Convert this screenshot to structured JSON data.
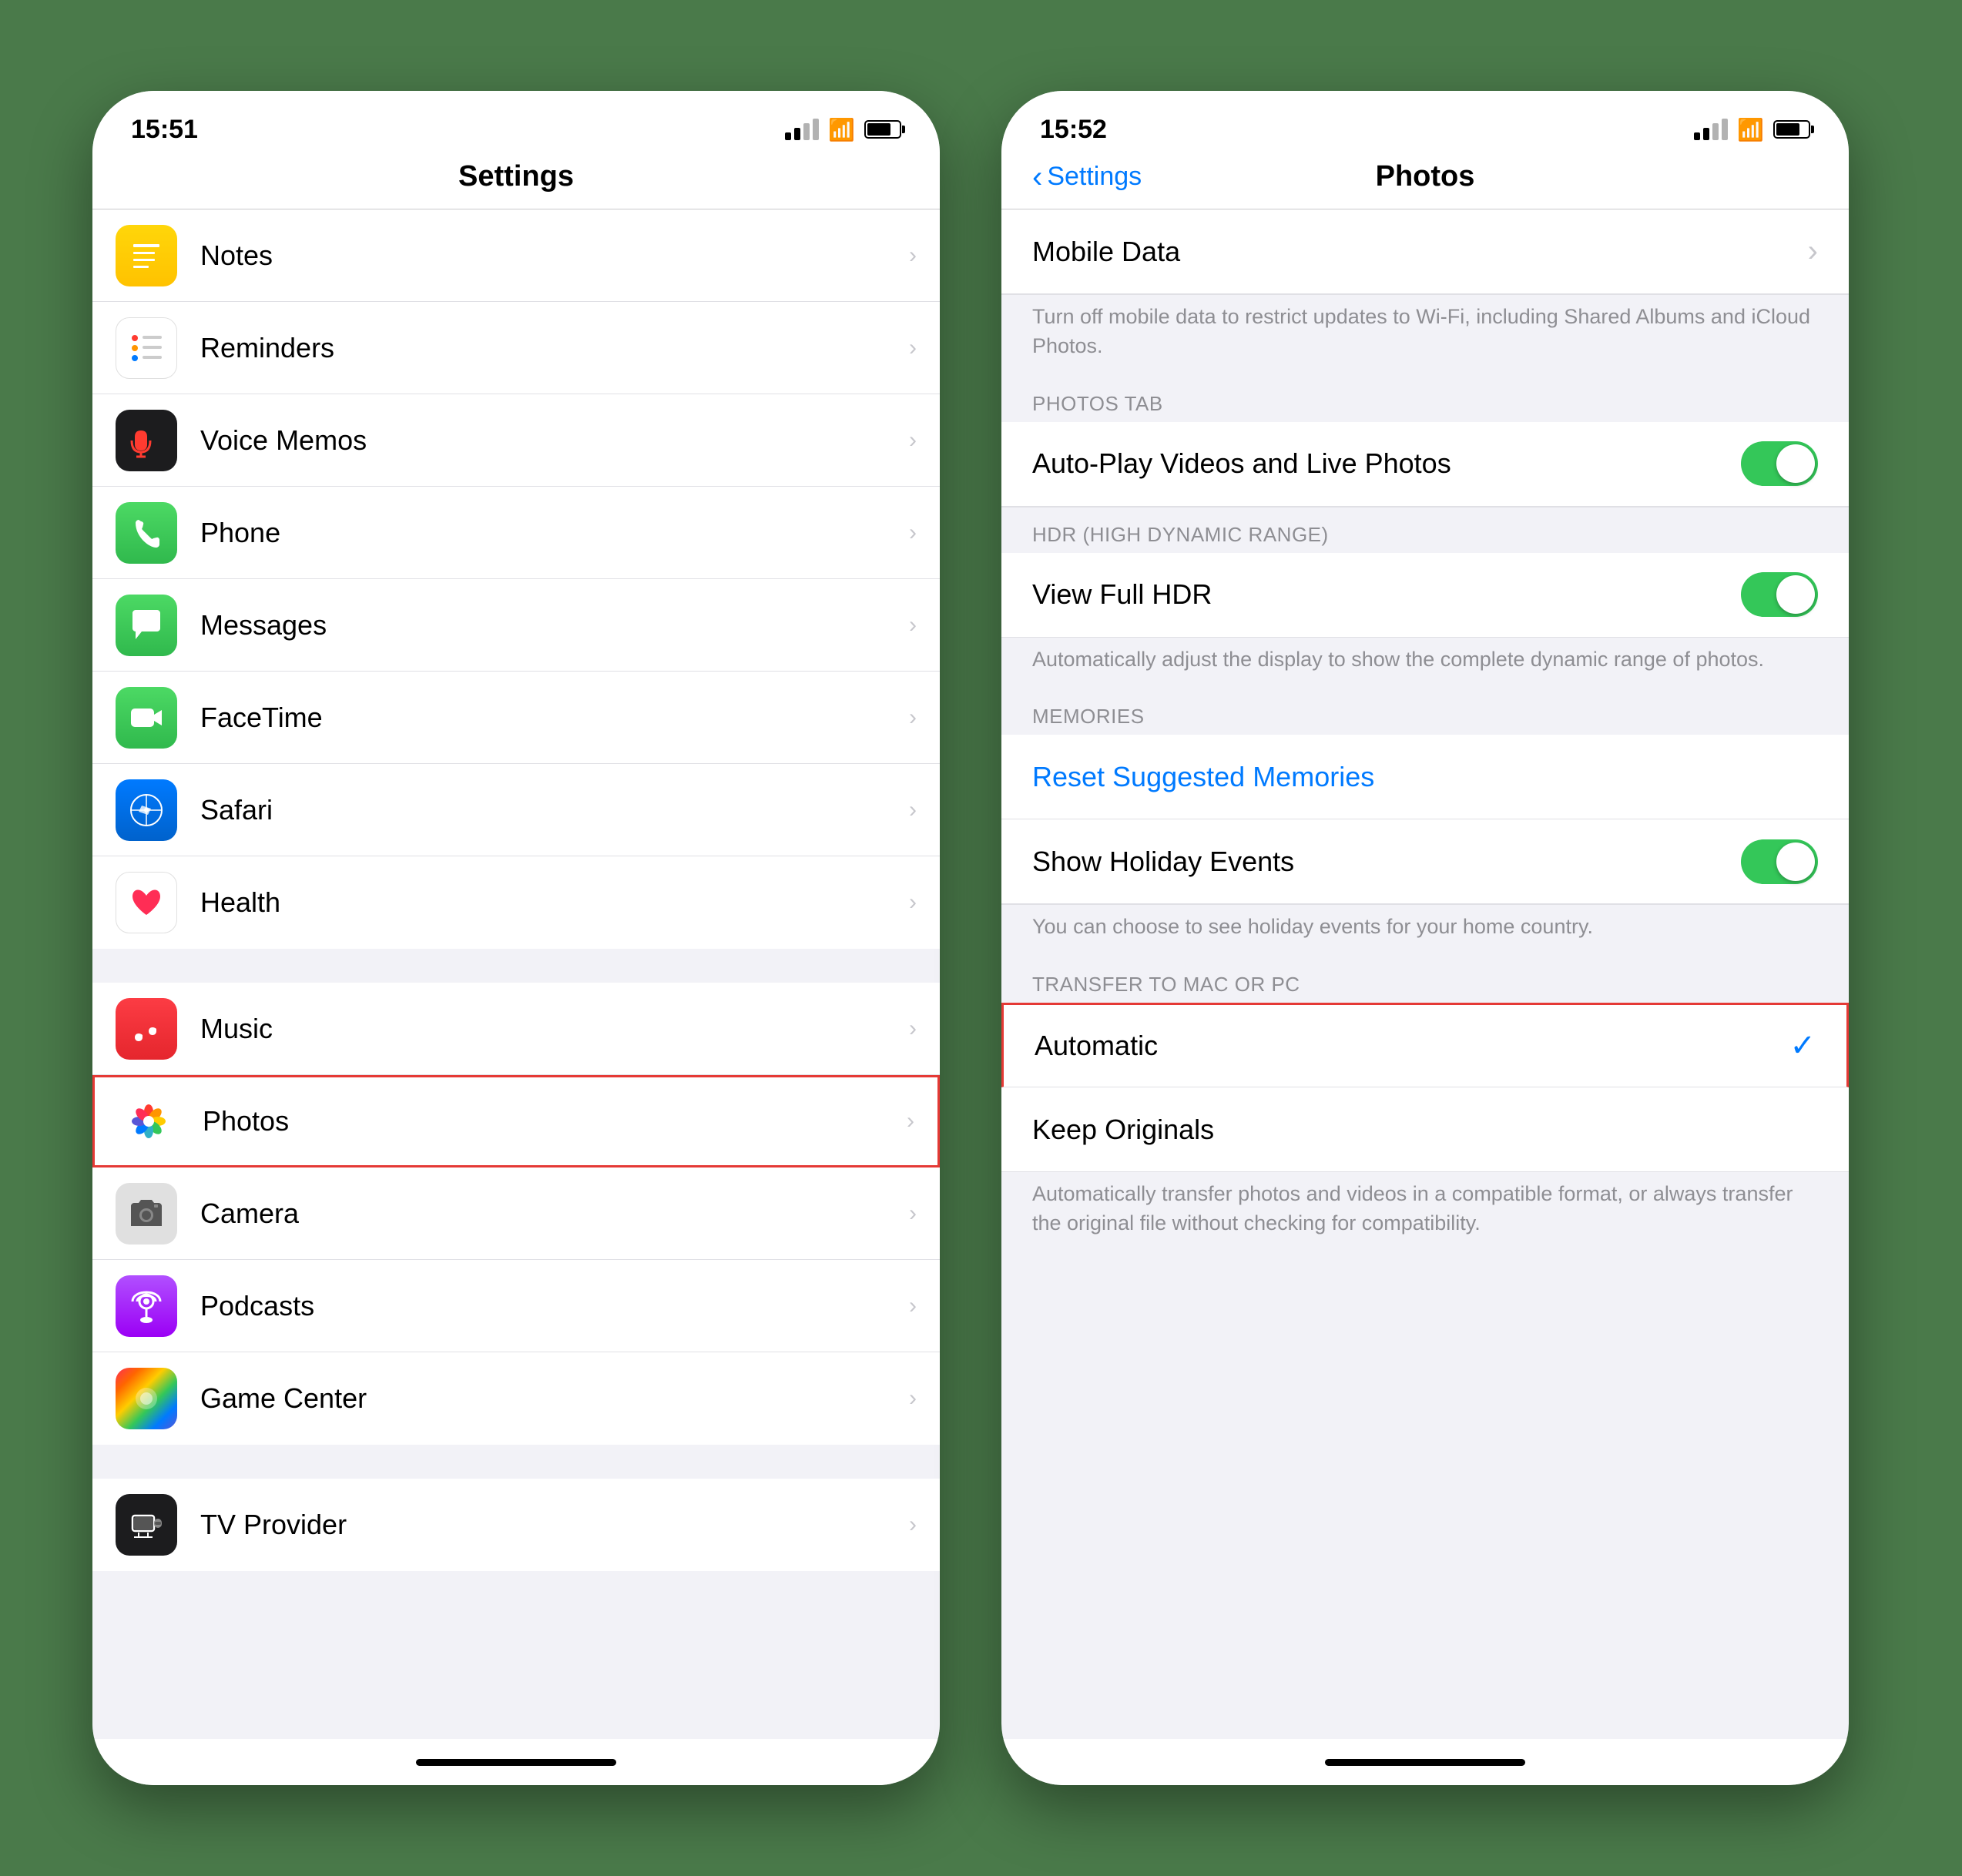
{
  "left_phone": {
    "status_bar": {
      "time": "15:51",
      "navigation_arrow": "◂"
    },
    "nav": {
      "title": "Settings"
    },
    "items": [
      {
        "id": "notes",
        "label": "Notes",
        "icon_type": "notes"
      },
      {
        "id": "reminders",
        "label": "Reminders",
        "icon_type": "reminders"
      },
      {
        "id": "voicememos",
        "label": "Voice Memos",
        "icon_type": "voicememos"
      },
      {
        "id": "phone",
        "label": "Phone",
        "icon_type": "phone"
      },
      {
        "id": "messages",
        "label": "Messages",
        "icon_type": "messages"
      },
      {
        "id": "facetime",
        "label": "FaceTime",
        "icon_type": "facetime"
      },
      {
        "id": "safari",
        "label": "Safari",
        "icon_type": "safari"
      },
      {
        "id": "health",
        "label": "Health",
        "icon_type": "health"
      }
    ],
    "items2": [
      {
        "id": "music",
        "label": "Music",
        "icon_type": "music"
      },
      {
        "id": "photos",
        "label": "Photos",
        "icon_type": "photos",
        "highlighted": true
      },
      {
        "id": "camera",
        "label": "Camera",
        "icon_type": "camera"
      },
      {
        "id": "podcasts",
        "label": "Podcasts",
        "icon_type": "podcasts"
      },
      {
        "id": "gamecenter",
        "label": "Game Center",
        "icon_type": "gamecenter"
      }
    ],
    "items3": [
      {
        "id": "tvprovider",
        "label": "TV Provider",
        "icon_type": "tvprovider"
      }
    ]
  },
  "right_phone": {
    "status_bar": {
      "time": "15:52",
      "navigation_arrow": "◂"
    },
    "nav": {
      "back_label": "Settings",
      "title": "Photos"
    },
    "sections": [
      {
        "id": "mobile-data",
        "rows": [
          {
            "id": "mobile-data-row",
            "label": "Mobile Data",
            "type": "chevron"
          }
        ],
        "footer": "Turn off mobile data to restrict updates to Wi-Fi, including Shared Albums and iCloud Photos."
      },
      {
        "id": "photos-tab",
        "header": "PHOTOS TAB",
        "rows": [
          {
            "id": "autoplay",
            "label": "Auto-Play Videos and Live Photos",
            "type": "toggle",
            "value": true
          }
        ]
      },
      {
        "id": "hdr",
        "header": "HDR (HIGH DYNAMIC RANGE)",
        "rows": [
          {
            "id": "view-full-hdr",
            "label": "View Full HDR",
            "type": "toggle",
            "value": true
          }
        ],
        "footer": "Automatically adjust the display to show the complete dynamic range of photos."
      },
      {
        "id": "memories",
        "header": "MEMORIES",
        "rows": [
          {
            "id": "reset-memories",
            "label": "Reset Suggested Memories",
            "type": "blue-link"
          },
          {
            "id": "show-holiday",
            "label": "Show Holiday Events",
            "type": "toggle",
            "value": true
          }
        ],
        "footer": "You can choose to see holiday events for your home country."
      },
      {
        "id": "transfer",
        "header": "TRANSFER TO MAC OR PC",
        "rows": [
          {
            "id": "automatic",
            "label": "Automatic",
            "type": "check",
            "highlighted": true
          },
          {
            "id": "keep-originals",
            "label": "Keep Originals",
            "type": "none"
          }
        ],
        "footer": "Automatically transfer photos and videos in a compatible format, or always transfer the original file without checking for compatibility."
      }
    ]
  }
}
